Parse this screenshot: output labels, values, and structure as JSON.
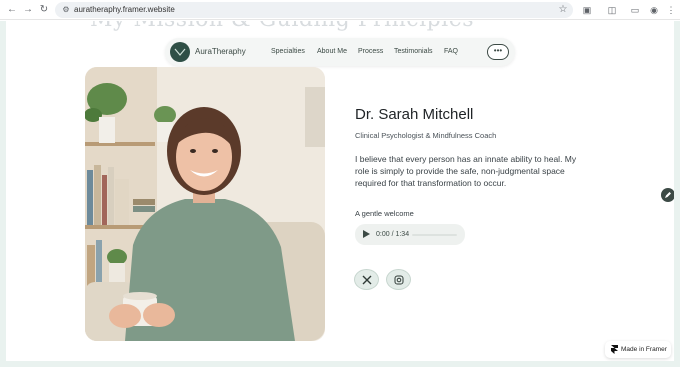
{
  "browser": {
    "url": "auratheraphy.framer.website",
    "icons": [
      "back-icon",
      "forward-icon",
      "reload-icon",
      "site-settings-icon",
      "bookmark-star-icon",
      "extensions-icon",
      "sidepanel-icon",
      "tab-search-icon",
      "profile-icon",
      "more-vert-icon"
    ]
  },
  "page": {
    "ghost_heading": "My Mission & Guiding Principles"
  },
  "nav": {
    "brand": "AuraTheraphy",
    "links": [
      "Specialties",
      "About Me",
      "Process",
      "Testimonials",
      "FAQ"
    ],
    "menu_label": "•••"
  },
  "profile": {
    "name": "Dr. Sarah Mitchell",
    "title": "Clinical Psychologist & Mindfulness Coach",
    "bio": "I believe that every person has an innate ability to heal. My role is simply to provide the safe, non-judgmental space required for that transformation to occur.",
    "welcome_label": "A gentle welcome",
    "audio_time": "0:00 / 1:34",
    "audio_progress": 0,
    "socials": [
      "x-icon",
      "instagram-icon"
    ]
  },
  "badge": {
    "label": "Made in Framer"
  },
  "colors": {
    "accent": "#2f4f46",
    "nav_bg": "#f4f6f5",
    "sweater": "#7f9a88",
    "page_border": "#e9f2ef"
  }
}
